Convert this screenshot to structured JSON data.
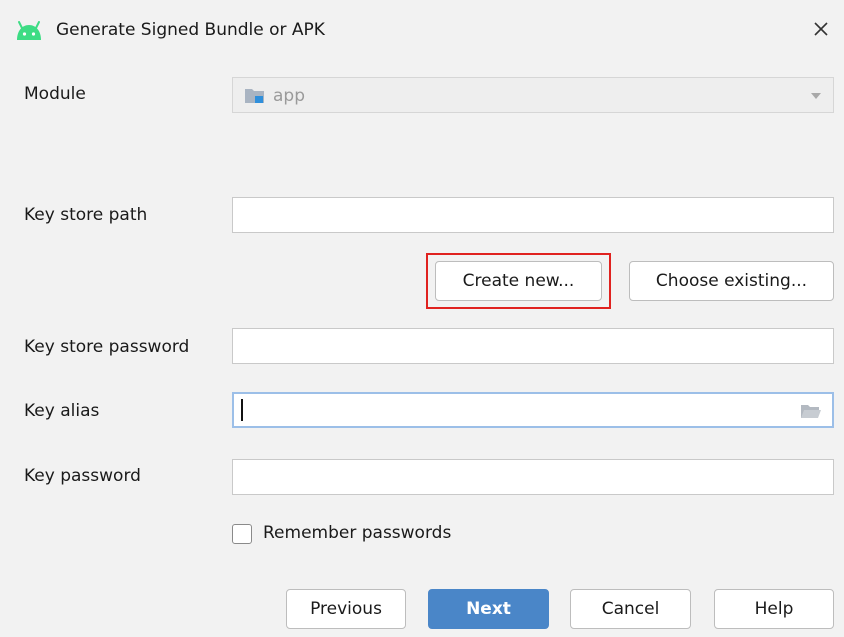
{
  "window": {
    "title": "Generate Signed Bundle or APK",
    "title_icon": "android-icon",
    "close_icon": "close-icon"
  },
  "form": {
    "module": {
      "label": "Module",
      "value": "app",
      "icon": "module-folder-icon"
    },
    "key_store_path": {
      "label": "Key store path",
      "value": ""
    },
    "key_store_buttons": {
      "create_new": "Create new...",
      "choose_existing": "Choose existing..."
    },
    "key_store_password": {
      "label": "Key store password",
      "value": ""
    },
    "key_alias": {
      "label": "Key alias",
      "value": "",
      "icon": "folder-open-icon"
    },
    "key_password": {
      "label": "Key password",
      "value": ""
    },
    "remember_passwords": {
      "label": "Remember passwords",
      "checked": false
    }
  },
  "footer": {
    "previous": "Previous",
    "next": "Next",
    "cancel": "Cancel",
    "help": "Help"
  },
  "colors": {
    "android_green": "#3ddc84",
    "primary_button": "#4a86c8",
    "highlight_red": "#e0221f",
    "focus_border": "#9cbfe8"
  }
}
